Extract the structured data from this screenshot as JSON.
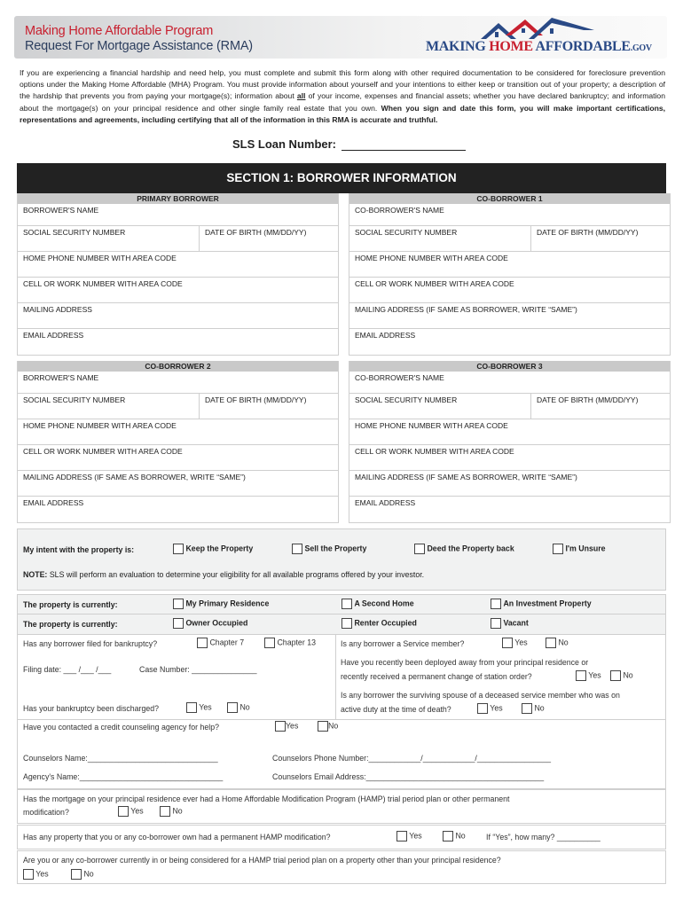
{
  "header": {
    "title_line1": "Making Home Affordable Program",
    "title_line2": "Request For Mortgage Assistance (RMA)",
    "logo": {
      "making": "MAKING ",
      "home": "HOME",
      "affordable": " AFFORDABLE",
      "gov": ".GOV",
      "icon": "houses-logo-icon"
    }
  },
  "intro": {
    "text": "If you are experiencing a financial hardship and need help, you must complete and submit this form along with other required documentation to be considered for foreclosure prevention options under the Making Home Affordable (MHA) Program. You must provide information about yourself and your intentions to either keep or transition out of your property; a description of the hardship that prevents you from paying your mortgage(s); information about ",
    "underlined": "all",
    "text2": " of your income, expenses and financial assets; whether you have declared bankruptcy; and information about the mortgage(s) on your principal residence and other single family real estate that you own. ",
    "bold": "When you sign and date this form, you will make important certifications, representations and agreements, including certifying that all of the information in this RMA is accurate and truthful."
  },
  "loan_number": {
    "label": "SLS Loan Number:",
    "value": ""
  },
  "section1": {
    "title": "SECTION 1: BORROWER INFORMATION",
    "borrowers": [
      {
        "heading": "PRIMARY BORROWER",
        "name_label": "BORROWER'S NAME",
        "ssn_label": "SOCIAL SECURITY NUMBER",
        "dob_label": "DATE OF BIRTH (MM/DD/YY)",
        "home_phone_label": "HOME PHONE NUMBER WITH AREA CODE",
        "cell_label": "CELL OR WORK NUMBER WITH AREA CODE",
        "address_label": "MAILING ADDRESS",
        "email_label": "EMAIL ADDRESS"
      },
      {
        "heading": "CO-BORROWER 1",
        "name_label": "CO-BORROWER'S NAME",
        "ssn_label": "SOCIAL SECURITY NUMBER",
        "dob_label": "DATE OF BIRTH (MM/DD/YY)",
        "home_phone_label": "HOME PHONE NUMBER WITH AREA CODE",
        "cell_label": "CELL OR WORK NUMBER WITH AREA CODE",
        "address_label": "MAILING ADDRESS (IF SAME AS BORROWER, WRITE “SAME”)",
        "email_label": "EMAIL ADDRESS"
      },
      {
        "heading": "CO-BORROWER 2",
        "name_label": "BORROWER'S NAME",
        "ssn_label": "SOCIAL SECURITY NUMBER",
        "dob_label": "DATE OF BIRTH (MM/DD/YY)",
        "home_phone_label": "HOME PHONE NUMBER WITH AREA CODE",
        "cell_label": "CELL OR WORK NUMBER WITH AREA CODE",
        "address_label": "MAILING ADDRESS (IF SAME AS BORROWER, WRITE “SAME”)",
        "email_label": "EMAIL ADDRESS"
      },
      {
        "heading": "CO-BORROWER 3",
        "name_label": "CO-BORROWER'S NAME",
        "ssn_label": "SOCIAL SECURITY NUMBER",
        "dob_label": "DATE OF BIRTH (MM/DD/YY)",
        "home_phone_label": "HOME PHONE NUMBER WITH AREA CODE",
        "cell_label": "CELL OR WORK NUMBER WITH AREA CODE",
        "address_label": "MAILING ADDRESS (IF SAME AS BORROWER, WRITE “SAME”)",
        "email_label": "EMAIL ADDRESS"
      }
    ]
  },
  "intent": {
    "label": "My intent with the property is:",
    "options": [
      "Keep the Property",
      "Sell the Property",
      "Deed  the Property back",
      "I'm Unsure"
    ],
    "note_bold": "NOTE:",
    "note": " SLS will perform an evaluation to determine your eligibility for all available programs offered by your investor."
  },
  "property": {
    "row1": {
      "label": "The property is currently:",
      "options": [
        "My Primary Residence",
        "A Second Home",
        "An Investment Property"
      ]
    },
    "row2": {
      "label": "The property is currently:",
      "options": [
        "Owner Occupied",
        "Renter Occupied",
        "Vacant"
      ]
    }
  },
  "bankruptcy": {
    "question": "Has any borrower filed for bankruptcy?",
    "options": [
      "Chapter 7",
      "Chapter 13"
    ],
    "filing_date": "Filing date: ___ /___ /___",
    "case_number": "Case Number: _______________",
    "discharged_q": "Has your bankruptcy been discharged?",
    "yes": "Yes",
    "no": "No"
  },
  "service": {
    "q1": "Is any borrower a Service member?",
    "q2_line1": "Have you recently been deployed away from your principal residence or",
    "q2_line2": "recently received a permanent change of station order?",
    "q3_line1": "Is any borrower the surviving spouse of a deceased service member who was on",
    "q3_line2": "active duty at the time of death?",
    "yes": "Yes",
    "no": "No"
  },
  "counseling": {
    "question": "Have you contacted a credit counseling agency for help?",
    "yes": "Yes",
    "no": "No",
    "counselor_name": "Counselors Name:______________________________",
    "counselor_phone": "Counselors Phone Number:____________/____________/_________________",
    "agency_name": "Agency's Name:_________________________________",
    "counselor_email": "Counselors Email Address:_________________________________________"
  },
  "hamp": {
    "q1_line1": "Has the mortgage on your principal residence ever had a Home Affordable Modification Program (HAMP) trial period plan or other permanent",
    "q1_line2": "modification?",
    "q2": "Has any property that you or any co-borrower own had a permanent HAMP modification?",
    "q2_howmany": "If “Yes”, how many? __________",
    "q3": "Are you or any co-borrower currently in or being considered for a HAMP trial period plan on a property other than your principal residence?",
    "yes": "Yes",
    "no": "No"
  },
  "colors": {
    "brand_red": "#c8202f",
    "brand_blue": "#2a4a86",
    "section_bg": "#222222",
    "subhead_bg": "#c9c9c9",
    "panel_bg": "#f1f2f2"
  }
}
